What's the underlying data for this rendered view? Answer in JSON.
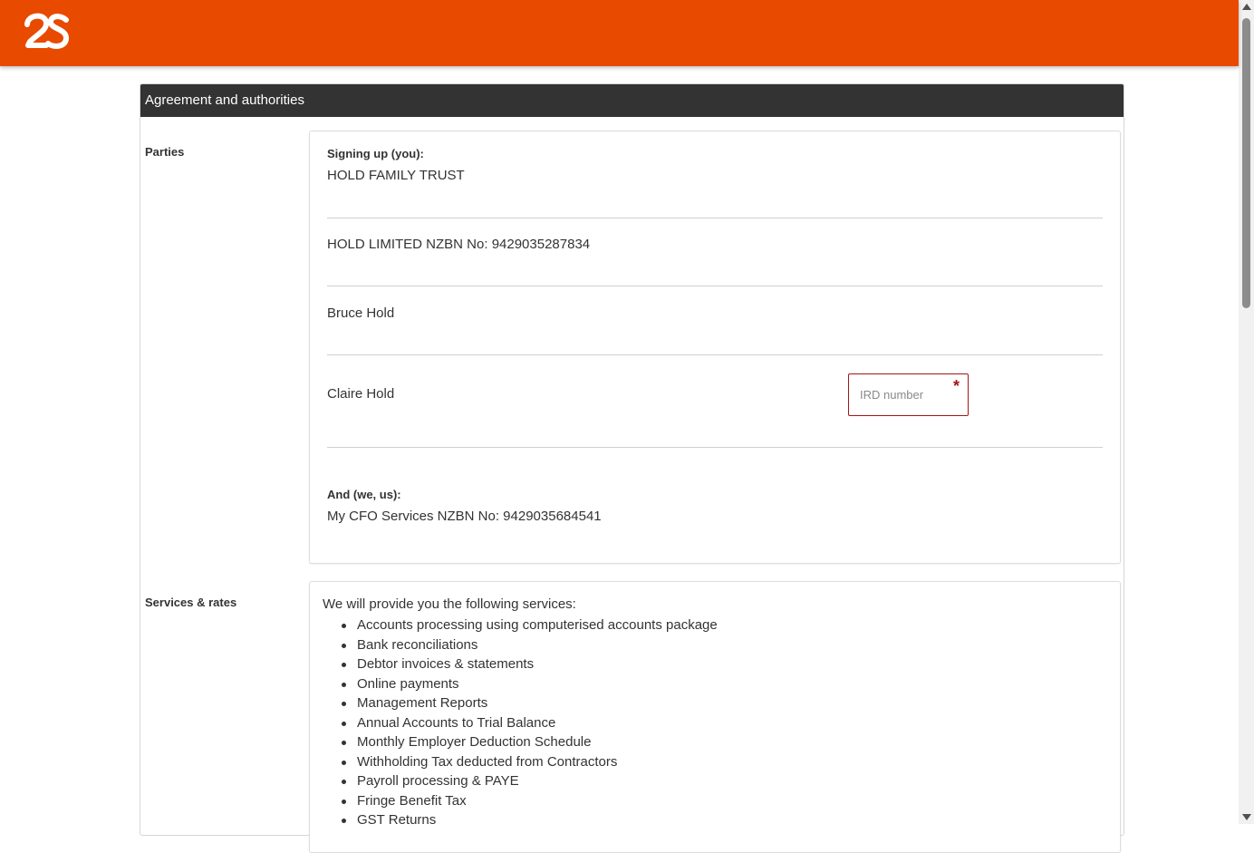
{
  "header": {
    "logo_text": "2S",
    "brand_color": "#e84a00"
  },
  "section": {
    "title": "Agreement and authorities"
  },
  "parties": {
    "label": "Parties",
    "signing_up_heading": "Signing up (you):",
    "entries": [
      "HOLD FAMILY TRUST",
      "HOLD LIMITED NZBN No: 9429035287834",
      "Bruce Hold",
      "Claire Hold"
    ],
    "ird_placeholder": "IRD number",
    "required_mark": "*",
    "us_heading": "And (we, us):",
    "us_entry": "My CFO Services NZBN No: 9429035684541"
  },
  "services": {
    "label": "Services & rates",
    "intro": "We will provide you the following services:",
    "items": [
      "Accounts processing using computerised accounts package",
      "Bank reconciliations",
      "Debtor invoices & statements",
      "Online payments",
      "Management Reports",
      "Annual Accounts to Trial Balance",
      "Monthly Employer Deduction Schedule",
      "Withholding Tax deducted from Contractors",
      "Payroll processing & PAYE",
      "Fringe Benefit Tax",
      "GST Returns"
    ]
  }
}
